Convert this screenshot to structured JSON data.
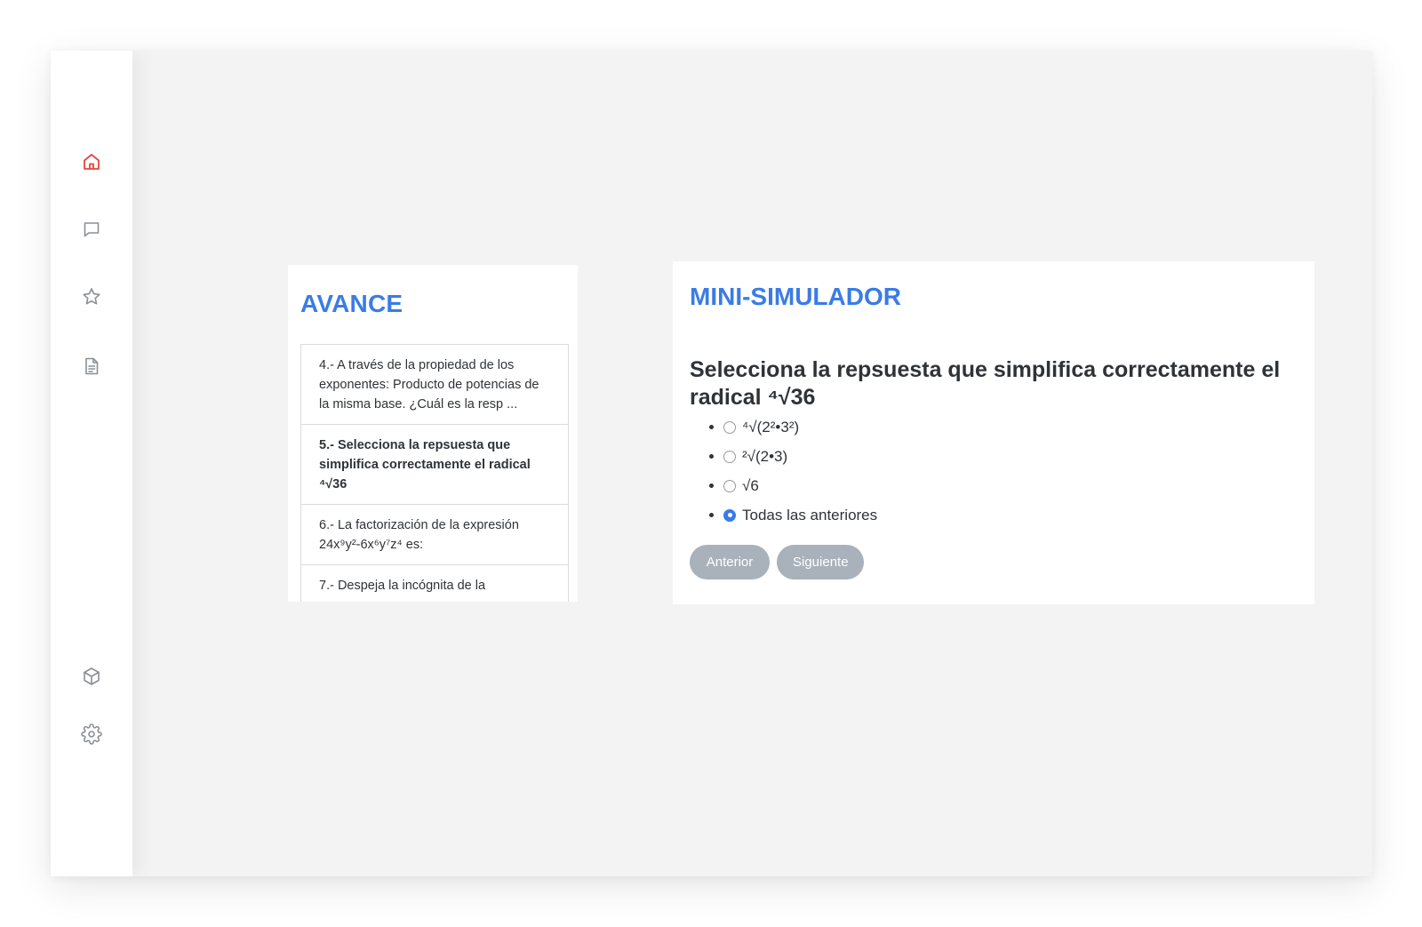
{
  "colors": {
    "accent": "#3a7ce6",
    "active_nav": "#e8453c",
    "icon_gray": "#8a8f95",
    "button_gray": "#a9b1ba",
    "text": "#2f3337"
  },
  "sidebar": {
    "items": [
      {
        "icon": "home-icon",
        "active": true
      },
      {
        "icon": "chat-icon",
        "active": false
      },
      {
        "icon": "star-icon",
        "active": false
      },
      {
        "icon": "document-icon",
        "active": false
      },
      {
        "icon": "cube-icon",
        "active": false
      },
      {
        "icon": "gear-icon",
        "active": false
      }
    ]
  },
  "avance": {
    "title": "AVANCE",
    "items": [
      {
        "text": "4.- A través de la propiedad de los exponentes: Producto de potencias de la misma base. ¿Cuál es la resp ...",
        "active": false
      },
      {
        "text": "5.- Selecciona la repsuesta que simplifica correctamente el radical ⁴√36",
        "active": true
      },
      {
        "text": "6.- La factorización de la expresión 24x⁹y²-6x⁶y⁷z⁴ es:",
        "active": false
      },
      {
        "text": "7.- Despeja la incógnita de la",
        "active": false
      }
    ]
  },
  "simulator": {
    "title": "MINI-SIMULADOR",
    "question": "Selecciona la repsuesta que simplifica correctamente el radical ⁴√36",
    "options": [
      {
        "label": "⁴√(2²•3²)",
        "selected": false
      },
      {
        "label": "²√(2•3)",
        "selected": false
      },
      {
        "label": "√6",
        "selected": false
      },
      {
        "label": "Todas las anteriores",
        "selected": true
      }
    ],
    "prev_label": "Anterior",
    "next_label": "Siguiente"
  }
}
